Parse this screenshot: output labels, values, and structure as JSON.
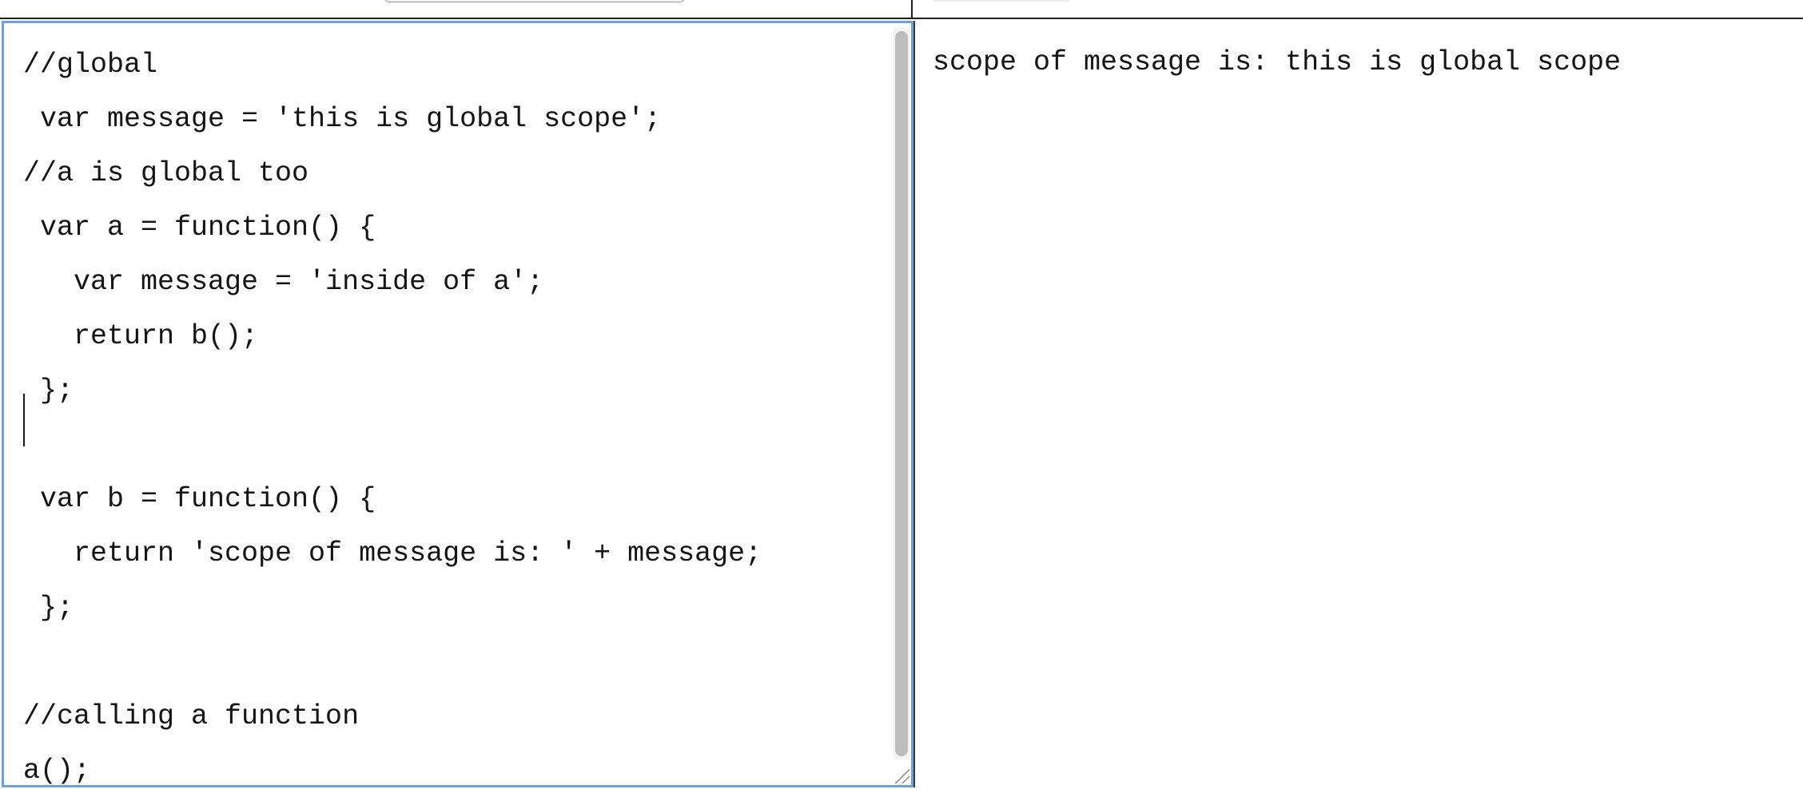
{
  "editor": {
    "lines": [
      "//global",
      " var message = 'this is global scope';",
      "//a is global too",
      " var a = function() {",
      "   var message = 'inside of a';",
      "   return b();",
      " };",
      "",
      " var b = function() {",
      "   return 'scope of message is: ' + message;",
      " };",
      "",
      "//calling a function",
      "a();"
    ]
  },
  "output": {
    "text": "scope of message is: this is global scope"
  },
  "colors": {
    "editor_focus_border": "#6d9fd9",
    "text": "#141414"
  },
  "icons": {
    "resize_grip": "resize-grip-icon"
  }
}
